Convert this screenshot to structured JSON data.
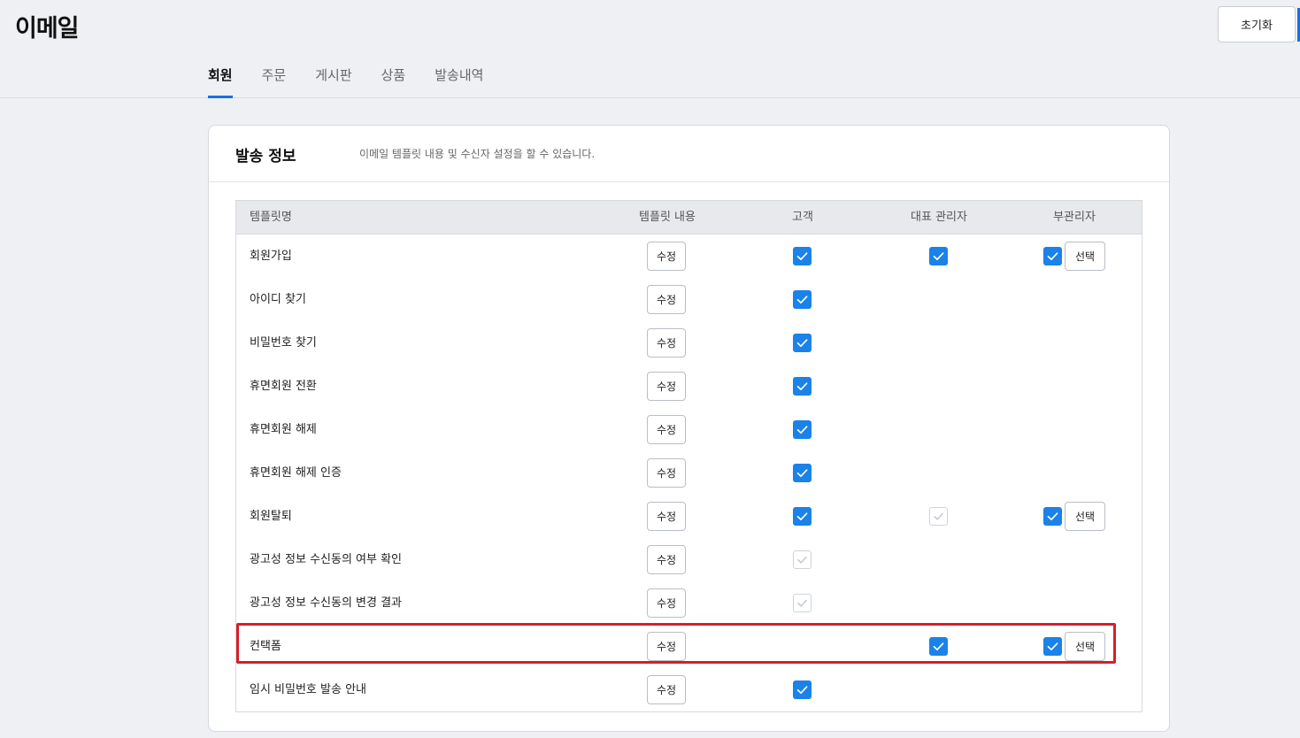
{
  "header": {
    "title": "이메일",
    "reset_label": "초기화"
  },
  "tabs": [
    {
      "label": "회원",
      "active": true
    },
    {
      "label": "주문",
      "active": false
    },
    {
      "label": "게시판",
      "active": false
    },
    {
      "label": "상품",
      "active": false
    },
    {
      "label": "발송내역",
      "active": false
    }
  ],
  "card": {
    "title": "발송 정보",
    "description": "이메일 템플릿 내용 및 수신자 설정을 할 수 있습니다."
  },
  "table": {
    "columns": [
      "템플릿명",
      "템플릿 내용",
      "고객",
      "대표 관리자",
      "부관리자"
    ],
    "edit_label": "수정",
    "select_label": "선택",
    "rows": [
      {
        "name": "회원가입",
        "customer": "checked",
        "main_admin": "checked",
        "sub_admin": "checked",
        "highlighted": false
      },
      {
        "name": "아이디 찾기",
        "customer": "checked",
        "main_admin": "none",
        "sub_admin": "none",
        "highlighted": false
      },
      {
        "name": "비밀번호 찾기",
        "customer": "checked",
        "main_admin": "none",
        "sub_admin": "none",
        "highlighted": false
      },
      {
        "name": "휴면회원 전환",
        "customer": "checked",
        "main_admin": "none",
        "sub_admin": "none",
        "highlighted": false
      },
      {
        "name": "휴면회원 해제",
        "customer": "checked",
        "main_admin": "none",
        "sub_admin": "none",
        "highlighted": false
      },
      {
        "name": "휴면회원 해제 인증",
        "customer": "checked",
        "main_admin": "none",
        "sub_admin": "none",
        "highlighted": false
      },
      {
        "name": "회원탈퇴",
        "customer": "checked",
        "main_admin": "disabled",
        "sub_admin": "checked",
        "highlighted": false
      },
      {
        "name": "광고성 정보 수신동의 여부 확인",
        "customer": "disabled",
        "main_admin": "none",
        "sub_admin": "none",
        "highlighted": false
      },
      {
        "name": "광고성 정보 수신동의 변경 결과",
        "customer": "disabled",
        "main_admin": "none",
        "sub_admin": "none",
        "highlighted": false
      },
      {
        "name": "컨택폼",
        "customer": "none",
        "main_admin": "checked",
        "sub_admin": "checked",
        "highlighted": true
      },
      {
        "name": "임시 비밀번호 발송 안내",
        "customer": "checked",
        "main_admin": "none",
        "sub_admin": "none",
        "highlighted": false
      }
    ]
  },
  "colors": {
    "accent": "#1a82e8",
    "tab_indicator": "#1a6fe0",
    "highlight": "#d81e2a"
  },
  "icons": {
    "checkbox": "check-icon"
  }
}
